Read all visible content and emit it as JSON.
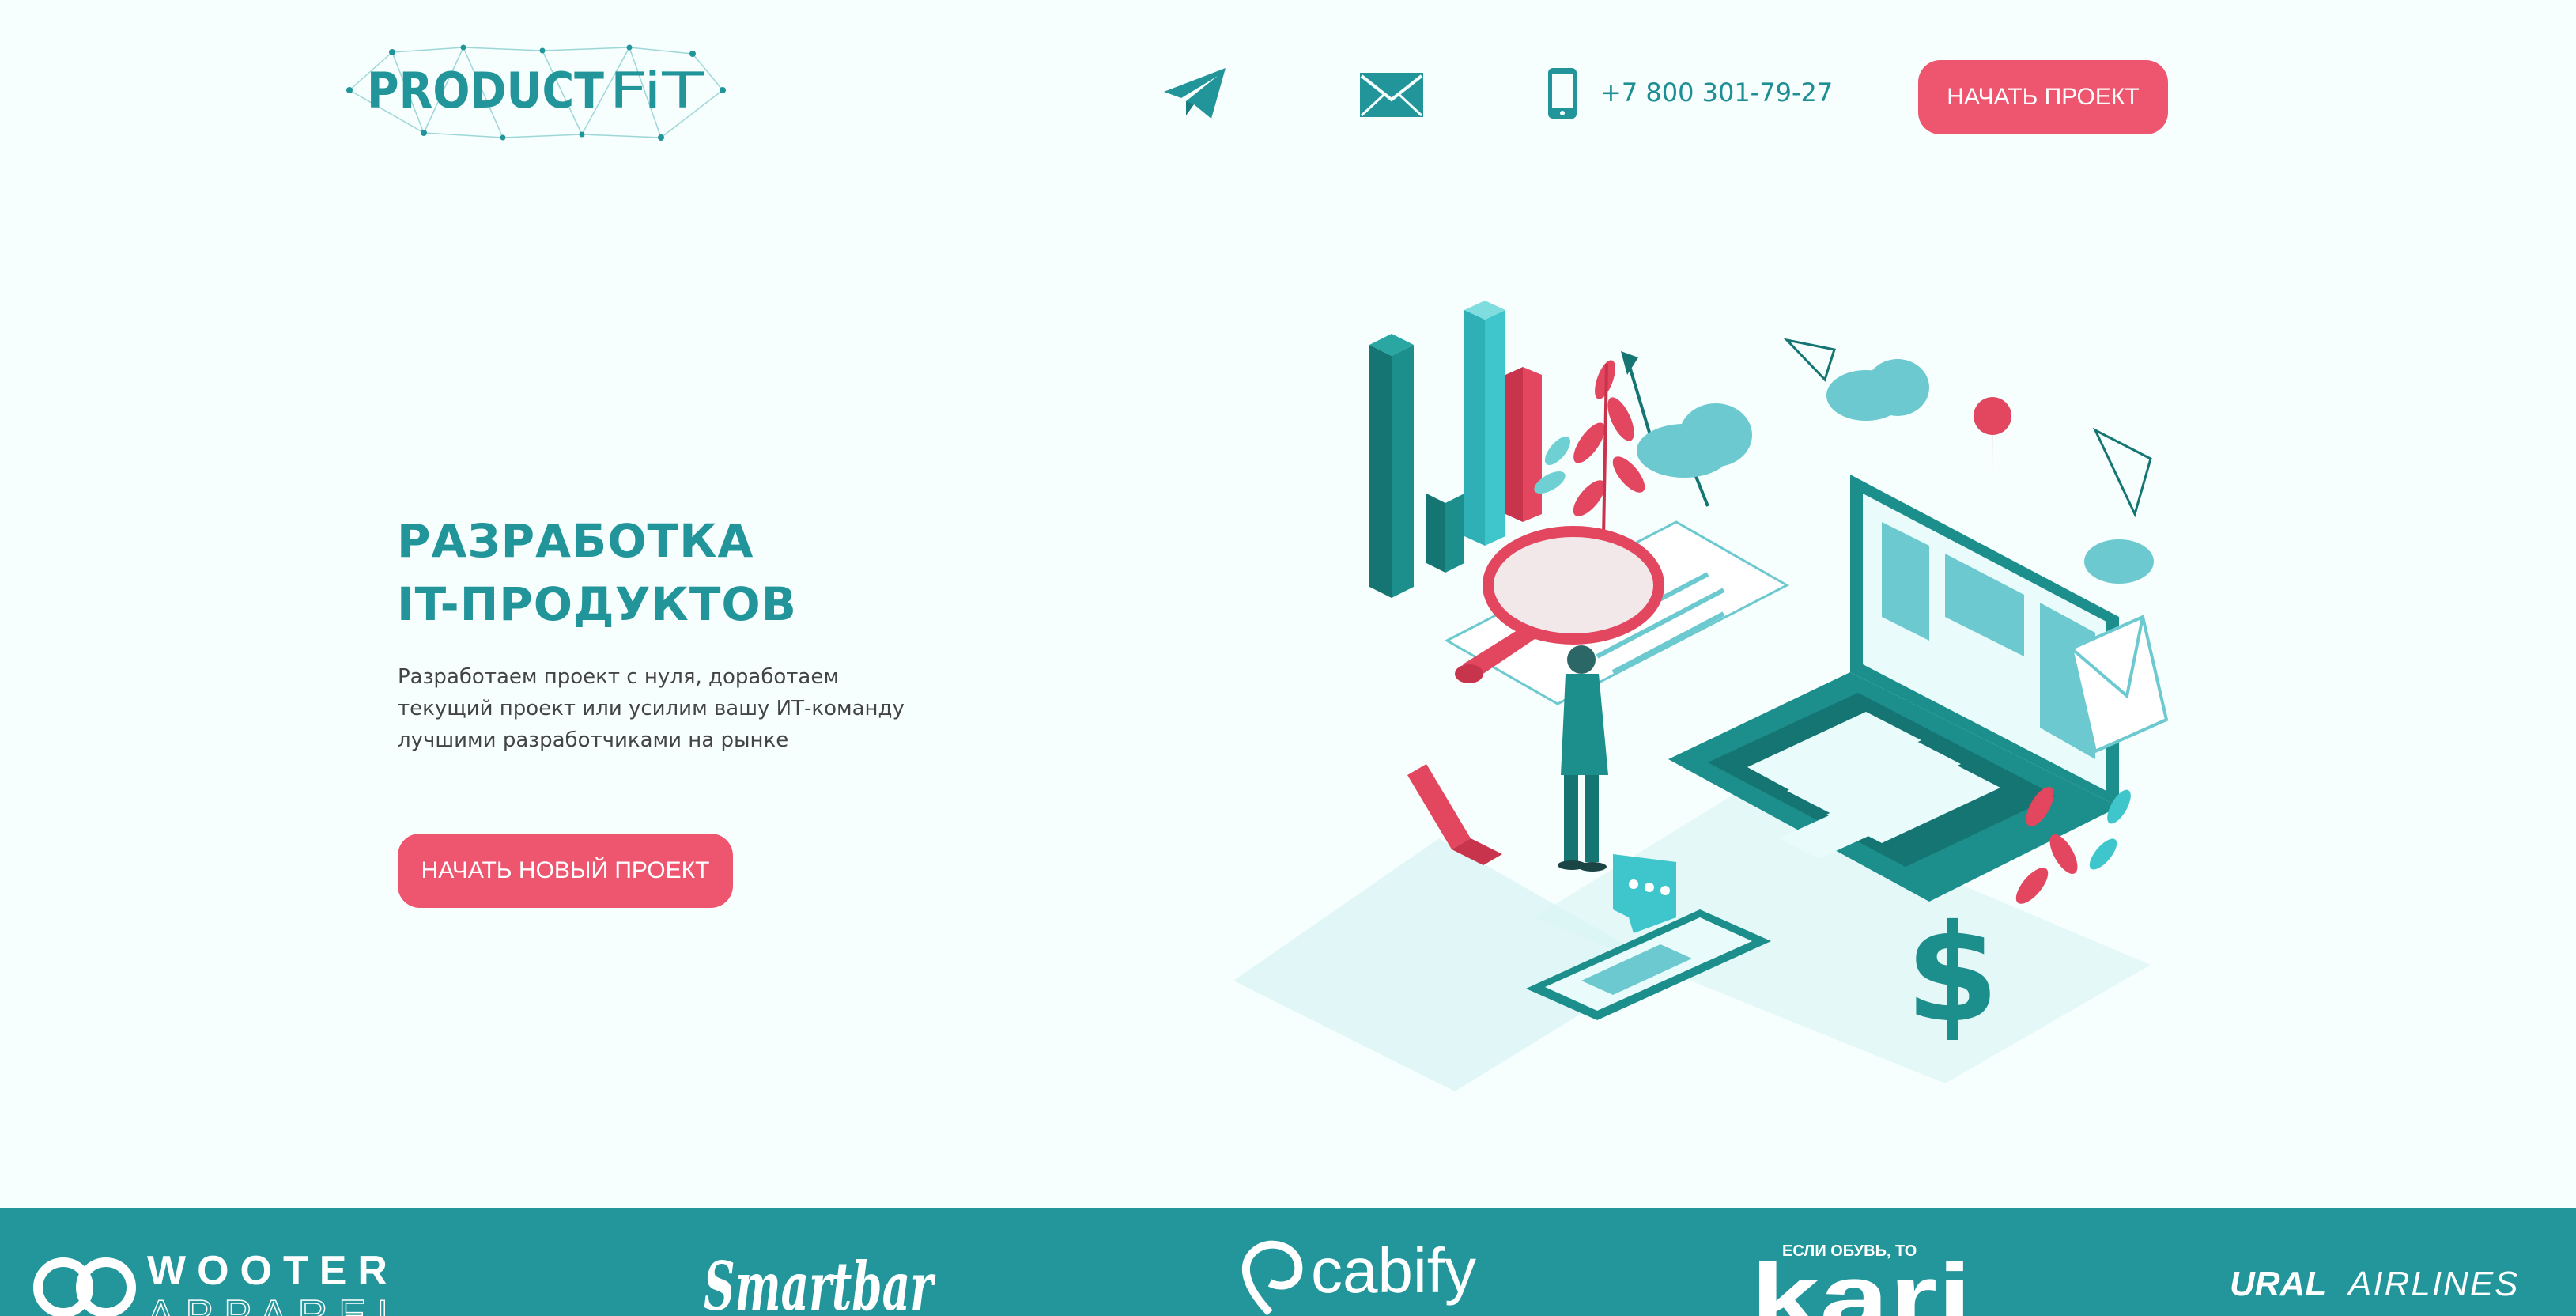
{
  "header": {
    "logo_text_product": "PRODUCT",
    "logo_text_fit": "FiT",
    "contacts": {
      "telegram_icon": "telegram-plane-icon",
      "email_icon": "envelope-icon",
      "phone_icon": "mobile-phone-icon",
      "phone": "+7 800 301-79-27"
    },
    "cta_label": "НАЧАТЬ ПРОЕКТ"
  },
  "hero": {
    "title_line1": "РАЗРАБОТКА",
    "title_line2": "IT-ПРОДУКТОВ",
    "desc_line1": "Разработаем проект с нуля, доработаем",
    "desc_line2": "текущий проект или усилим вашу ИТ-команду",
    "desc_line3": "лучшими разработчиками на рынке",
    "cta_label": "НАЧАТЬ НОВЫЙ ПРОЕКТ"
  },
  "clients": {
    "wooter_top": "WOOTER",
    "wooter_bottom": "APPAREL",
    "smartbar": "Smartbar",
    "cabify": "cabify",
    "kari_tag": "ЕСЛИ ОБУВЬ, ТО",
    "kari": "kari",
    "ural_bold": "URAL",
    "ural_light": "AIRLINES"
  },
  "colors": {
    "brand_teal": "#22959a",
    "accent_pink": "#ee5670",
    "background": "#f6fffe",
    "strip": "#22969b"
  }
}
